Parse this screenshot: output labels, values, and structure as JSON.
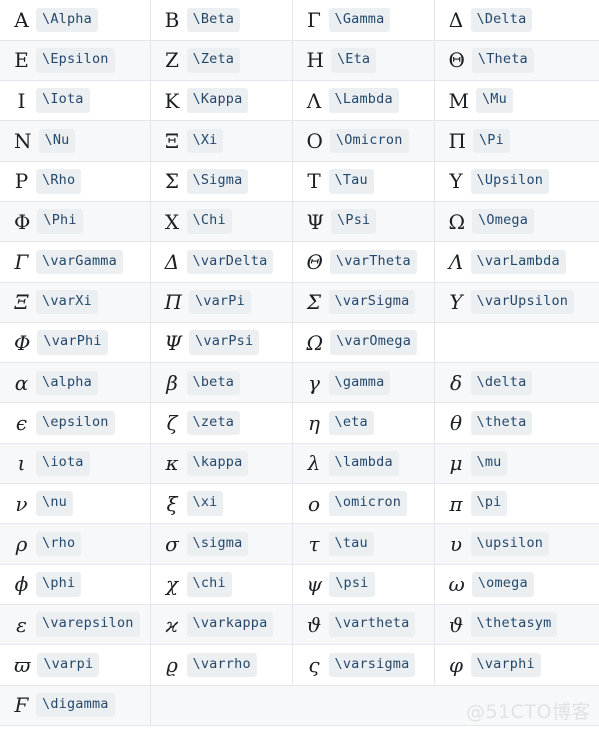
{
  "watermark": "@51CTO博客",
  "table": {
    "columns": 4,
    "styles": {
      "row_odd_bg": "#ffffff",
      "row_even_bg": "#f7f8fa",
      "border": "#e3e6ea",
      "code_bg": "#eceff2",
      "code_fg": "#24486b",
      "glyph_fg": "#1b1f23",
      "watermark_fg": "#e2e2e2"
    },
    "rows": [
      [
        {
          "glyph": "Α",
          "code": "\\Alpha",
          "italic": false
        },
        {
          "glyph": "Β",
          "code": "\\Beta",
          "italic": false
        },
        {
          "glyph": "Γ",
          "code": "\\Gamma",
          "italic": false
        },
        {
          "glyph": "Δ",
          "code": "\\Delta",
          "italic": false
        }
      ],
      [
        {
          "glyph": "Ε",
          "code": "\\Epsilon",
          "italic": false
        },
        {
          "glyph": "Ζ",
          "code": "\\Zeta",
          "italic": false
        },
        {
          "glyph": "Η",
          "code": "\\Eta",
          "italic": false
        },
        {
          "glyph": "Θ",
          "code": "\\Theta",
          "italic": false
        }
      ],
      [
        {
          "glyph": "Ι",
          "code": "\\Iota",
          "italic": false
        },
        {
          "glyph": "Κ",
          "code": "\\Kappa",
          "italic": false
        },
        {
          "glyph": "Λ",
          "code": "\\Lambda",
          "italic": false
        },
        {
          "glyph": "Μ",
          "code": "\\Mu",
          "italic": false
        }
      ],
      [
        {
          "glyph": "Ν",
          "code": "\\Nu",
          "italic": false
        },
        {
          "glyph": "Ξ",
          "code": "\\Xi",
          "italic": false
        },
        {
          "glyph": "Ο",
          "code": "\\Omicron",
          "italic": false
        },
        {
          "glyph": "Π",
          "code": "\\Pi",
          "italic": false
        }
      ],
      [
        {
          "glyph": "Ρ",
          "code": "\\Rho",
          "italic": false
        },
        {
          "glyph": "Σ",
          "code": "\\Sigma",
          "italic": false
        },
        {
          "glyph": "Τ",
          "code": "\\Tau",
          "italic": false
        },
        {
          "glyph": "Υ",
          "code": "\\Upsilon",
          "italic": false
        }
      ],
      [
        {
          "glyph": "Φ",
          "code": "\\Phi",
          "italic": false
        },
        {
          "glyph": "Χ",
          "code": "\\Chi",
          "italic": false
        },
        {
          "glyph": "Ψ",
          "code": "\\Psi",
          "italic": false
        },
        {
          "glyph": "Ω",
          "code": "\\Omega",
          "italic": false
        }
      ],
      [
        {
          "glyph": "Γ",
          "code": "\\varGamma",
          "italic": true
        },
        {
          "glyph": "Δ",
          "code": "\\varDelta",
          "italic": true
        },
        {
          "glyph": "Θ",
          "code": "\\varTheta",
          "italic": true
        },
        {
          "glyph": "Λ",
          "code": "\\varLambda",
          "italic": true
        }
      ],
      [
        {
          "glyph": "Ξ",
          "code": "\\varXi",
          "italic": true
        },
        {
          "glyph": "Π",
          "code": "\\varPi",
          "italic": true
        },
        {
          "glyph": "Σ",
          "code": "\\varSigma",
          "italic": true
        },
        {
          "glyph": "Υ",
          "code": "\\varUpsilon",
          "italic": true
        }
      ],
      [
        {
          "glyph": "Φ",
          "code": "\\varPhi",
          "italic": true
        },
        {
          "glyph": "Ψ",
          "code": "\\varPsi",
          "italic": true
        },
        {
          "glyph": "Ω",
          "code": "\\varOmega",
          "italic": true
        },
        {
          "glyph": "",
          "code": "",
          "italic": false,
          "empty": true
        }
      ],
      [
        {
          "glyph": "α",
          "code": "\\alpha",
          "italic": true
        },
        {
          "glyph": "β",
          "code": "\\beta",
          "italic": true
        },
        {
          "glyph": "γ",
          "code": "\\gamma",
          "italic": true
        },
        {
          "glyph": "δ",
          "code": "\\delta",
          "italic": true
        }
      ],
      [
        {
          "glyph": "ϵ",
          "code": "\\epsilon",
          "italic": true
        },
        {
          "glyph": "ζ",
          "code": "\\zeta",
          "italic": true
        },
        {
          "glyph": "η",
          "code": "\\eta",
          "italic": true
        },
        {
          "glyph": "θ",
          "code": "\\theta",
          "italic": true
        }
      ],
      [
        {
          "glyph": "ι",
          "code": "\\iota",
          "italic": true
        },
        {
          "glyph": "κ",
          "code": "\\kappa",
          "italic": true
        },
        {
          "glyph": "λ",
          "code": "\\lambda",
          "italic": true
        },
        {
          "glyph": "μ",
          "code": "\\mu",
          "italic": true
        }
      ],
      [
        {
          "glyph": "ν",
          "code": "\\nu",
          "italic": true
        },
        {
          "glyph": "ξ",
          "code": "\\xi",
          "italic": true
        },
        {
          "glyph": "ο",
          "code": "\\omicron",
          "italic": true
        },
        {
          "glyph": "π",
          "code": "\\pi",
          "italic": true
        }
      ],
      [
        {
          "glyph": "ρ",
          "code": "\\rho",
          "italic": true
        },
        {
          "glyph": "σ",
          "code": "\\sigma",
          "italic": true
        },
        {
          "glyph": "τ",
          "code": "\\tau",
          "italic": true
        },
        {
          "glyph": "υ",
          "code": "\\upsilon",
          "italic": true
        }
      ],
      [
        {
          "glyph": "ϕ",
          "code": "\\phi",
          "italic": true
        },
        {
          "glyph": "χ",
          "code": "\\chi",
          "italic": true
        },
        {
          "glyph": "ψ",
          "code": "\\psi",
          "italic": true
        },
        {
          "glyph": "ω",
          "code": "\\omega",
          "italic": true
        }
      ],
      [
        {
          "glyph": "ε",
          "code": "\\varepsilon",
          "italic": true
        },
        {
          "glyph": "ϰ",
          "code": "\\varkappa",
          "italic": true
        },
        {
          "glyph": "ϑ",
          "code": "\\vartheta",
          "italic": true
        },
        {
          "glyph": "ϑ",
          "code": "\\thetasym",
          "italic": true
        }
      ],
      [
        {
          "glyph": "ϖ",
          "code": "\\varpi",
          "italic": true
        },
        {
          "glyph": "ϱ",
          "code": "\\varrho",
          "italic": true
        },
        {
          "glyph": "ς",
          "code": "\\varsigma",
          "italic": true
        },
        {
          "glyph": "φ",
          "code": "\\varphi",
          "italic": true
        }
      ],
      [
        {
          "glyph": "Ϝ",
          "code": "\\digamma",
          "italic": true
        },
        {
          "glyph": "",
          "code": "",
          "italic": false,
          "empty": true
        },
        {
          "glyph": "",
          "code": "",
          "italic": false,
          "empty": true
        },
        {
          "glyph": "",
          "code": "",
          "italic": false,
          "empty": true
        }
      ]
    ]
  }
}
